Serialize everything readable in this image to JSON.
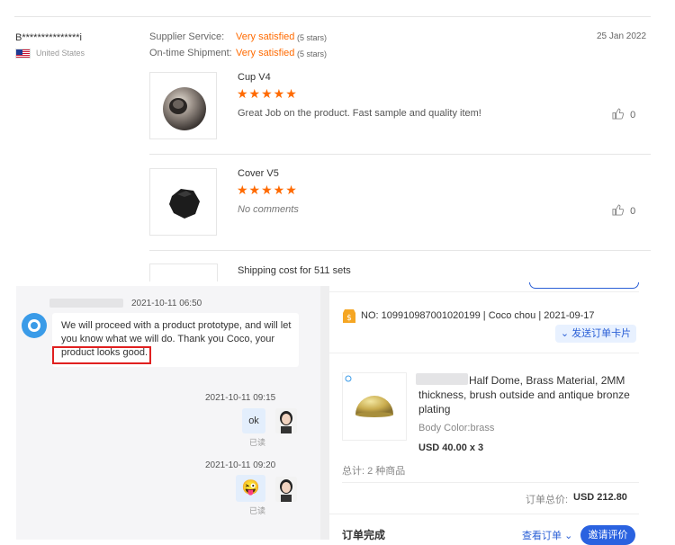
{
  "review": {
    "reviewer": "B***************i",
    "country": "United States",
    "date": "25 Jan 2022",
    "supplier_service_label": "Supplier Service:",
    "supplier_service_value": "Very satisfied",
    "supplier_service_stars": "(5 stars)",
    "shipment_label": "On-time Shipment:",
    "shipment_value": "Very satisfied",
    "shipment_stars": "(5 stars)",
    "items": [
      {
        "name": "Cup V4",
        "stars": "★★★★★",
        "rating": 5,
        "text": "Great Job on the product. Fast sample and quality item!",
        "likes": "0"
      },
      {
        "name": "Cover V5",
        "stars": "★★★★★",
        "rating": 5,
        "text": "No comments",
        "likes": "0"
      }
    ],
    "shipping_line": "Shipping cost for 511 sets"
  },
  "chat": {
    "msg1_time": "2021-10-11 06:50",
    "msg1_text": "We will proceed with a product prototype, and will let you know what we will do. Thank you Coco, your product looks good.",
    "msg2_time": "2021-10-11 09:15",
    "msg2_text": "ok",
    "msg2_status": "已读",
    "msg3_time": "2021-10-11 09:20",
    "msg3_emoji": "😜",
    "msg3_status": "已读"
  },
  "order": {
    "number": "NO: 109910987001020199 | Coco chou | 2021-09-17",
    "send_card": "发送订单卡片",
    "product_title": "Half Dome, Brass Material, 2MM thickness, brush outside and antique bronze plating",
    "body_color": "Body Color:brass",
    "price_qty": "USD 40.00 x 3",
    "total_items": "总计: 2 种商品",
    "total_label": "订单总价:",
    "total_value": "USD 212.80",
    "status": "订单完成",
    "view_order": "查看订单",
    "invite_review": "邀请评价"
  },
  "colors": {
    "accent": "#ff6a00",
    "link": "#2a5fd6",
    "highlight": "#e02020"
  }
}
